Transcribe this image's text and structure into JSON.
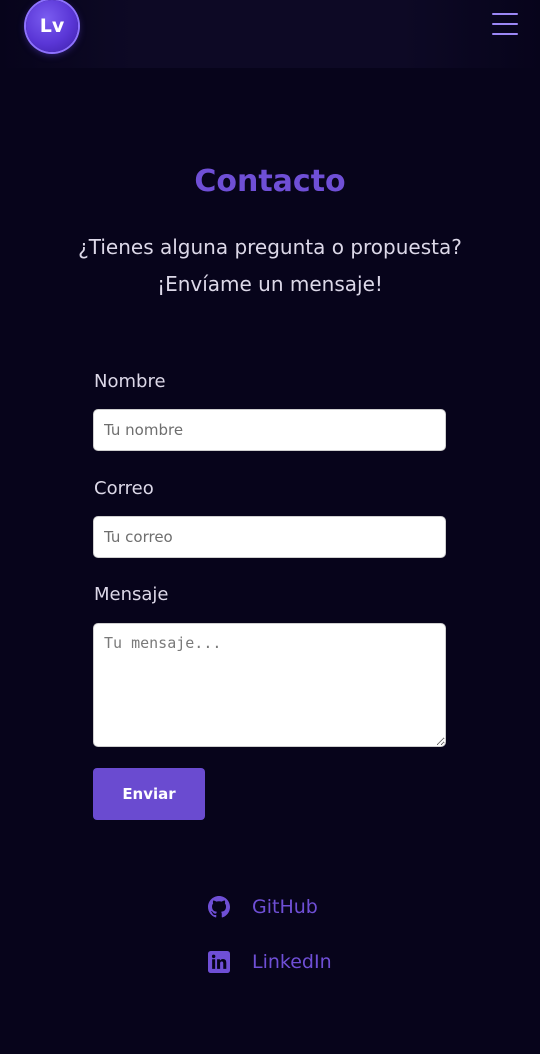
{
  "header": {
    "logo_text": "Lv",
    "menu_icon": "hamburger-menu-icon"
  },
  "contact": {
    "title": "Contacto",
    "subtitle_line1": "¿Tienes alguna pregunta o propuesta?",
    "subtitle_line2": "¡Envíame un mensaje!"
  },
  "form": {
    "name_label": "Nombre",
    "name_placeholder": "Tu nombre",
    "name_value": "",
    "email_label": "Correo",
    "email_placeholder": "Tu correo",
    "email_value": "",
    "message_label": "Mensaje",
    "message_placeholder": "Tu mensaje...",
    "message_value": "",
    "submit_label": "Enviar"
  },
  "social": [
    {
      "label": "GitHub",
      "icon": "github-icon"
    },
    {
      "label": "LinkedIn",
      "icon": "linkedin-icon"
    }
  ],
  "colors": {
    "background": "#07041b",
    "accent": "#6f4fd6",
    "button": "#6a4bd0",
    "text": "#dcd8e8"
  }
}
